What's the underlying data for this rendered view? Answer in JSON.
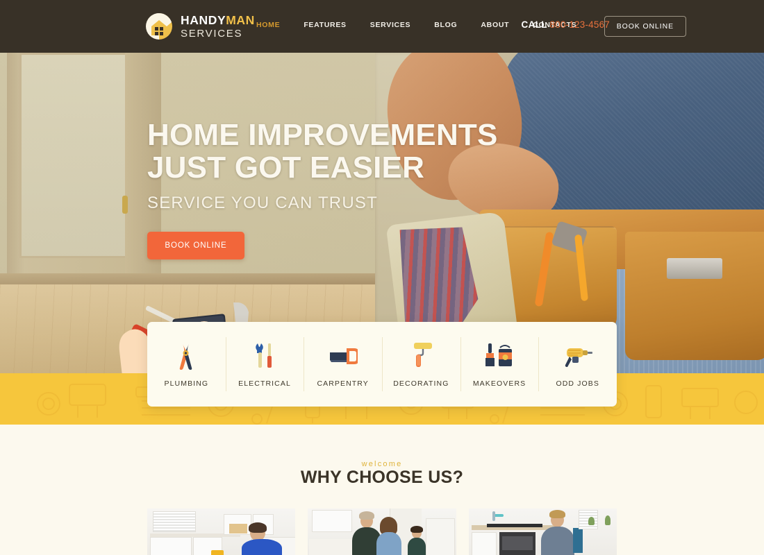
{
  "header": {
    "logo": {
      "line1_a": "HANDY",
      "line1_b": "MAN",
      "line2": "SERVICES",
      "icon": "house-circle-logo-icon"
    },
    "nav": [
      {
        "label": "HOME",
        "active": true
      },
      {
        "label": "FEATURES",
        "active": false
      },
      {
        "label": "SERVICES",
        "active": false
      },
      {
        "label": "BLOG",
        "active": false
      },
      {
        "label": "ABOUT",
        "active": false
      },
      {
        "label": "CONTACTS",
        "active": false
      }
    ],
    "call_label": "CALL",
    "call_number": "800-123-4567",
    "book_button": "BOOK ONLINE"
  },
  "hero": {
    "title_line1": "HOME IMPROVEMENTS",
    "title_line2": "JUST GOT EASIER",
    "subtitle": "SERVICE YOU CAN TRUST",
    "cta": "BOOK ONLINE"
  },
  "services": [
    {
      "label": "PLUMBING",
      "icon": "pliers-icon"
    },
    {
      "label": "ELECTRICAL",
      "icon": "wrench-screwdriver-icon"
    },
    {
      "label": "CARPENTRY",
      "icon": "handsaw-icon"
    },
    {
      "label": "DECORATING",
      "icon": "paint-roller-icon"
    },
    {
      "label": "MAKEOVERS",
      "icon": "paintbrush-bucket-icon"
    },
    {
      "label": "ODD JOBS",
      "icon": "power-drill-icon"
    }
  ],
  "why": {
    "eyebrow": "welcome",
    "title": "WHY CHOOSE US?",
    "cards": [
      {
        "scene": "handyman-repairing-kitchen-cabinet"
      },
      {
        "scene": "couple-with-child-in-kitchen"
      },
      {
        "scene": "technician-installing-oven"
      }
    ]
  },
  "colors": {
    "header_bg": "#383127",
    "accent_orange": "#F2663A",
    "accent_gold": "#D59A2E",
    "band_yellow": "#F6C63C",
    "page_cream": "#FCF9EE",
    "card_cream": "#FDFBEF",
    "text_dark": "#3B3428"
  }
}
